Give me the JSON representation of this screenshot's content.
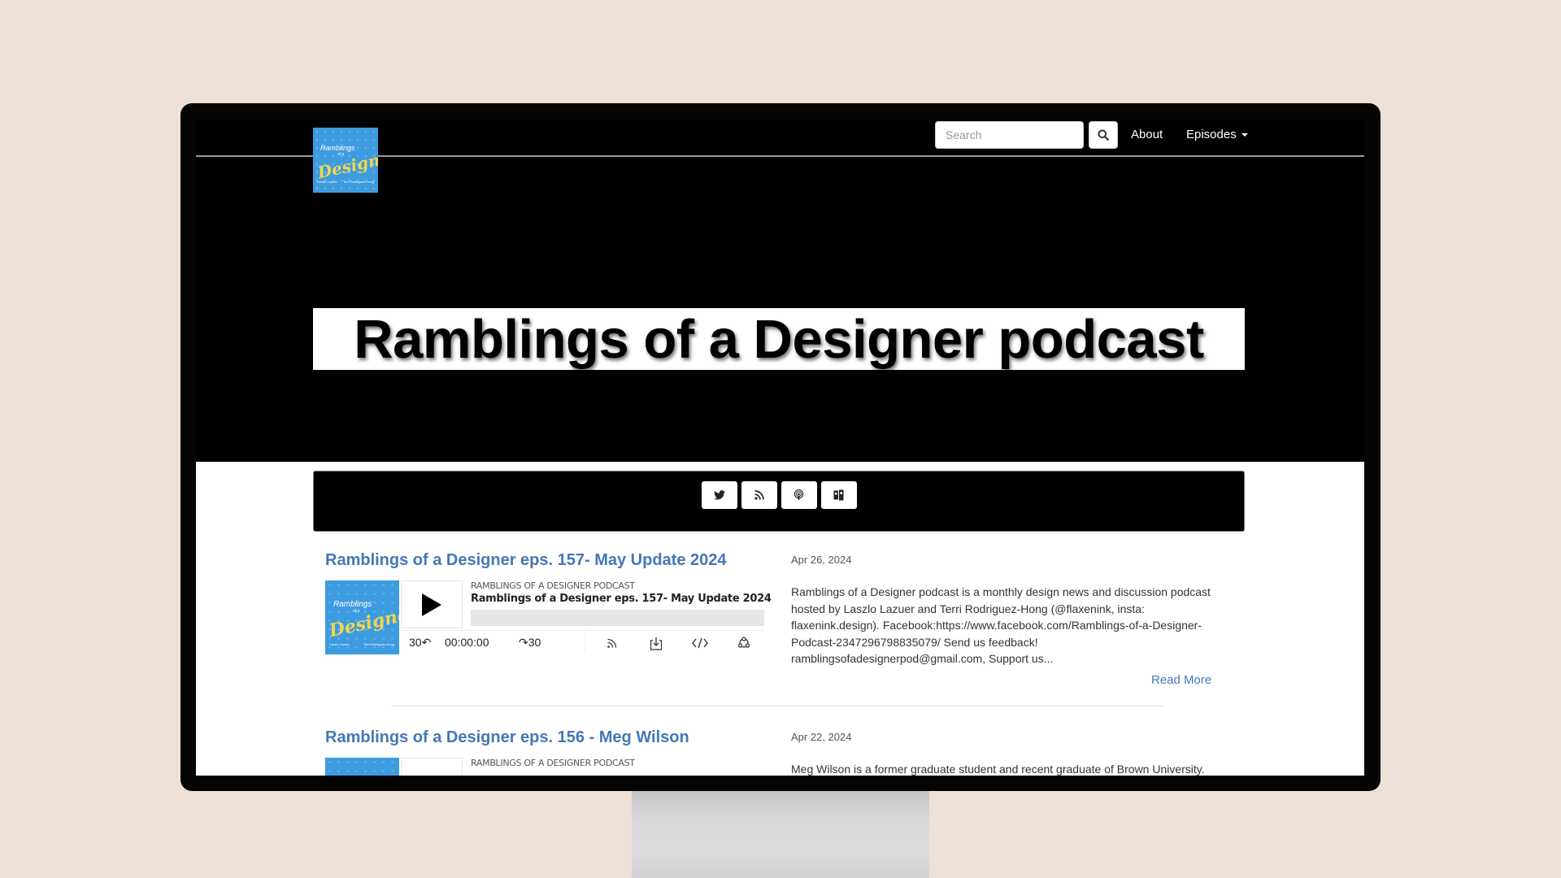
{
  "nav": {
    "logo_alt": "Ramblings of a Designer logo",
    "logo_lines": [
      "Ramblings",
      "of a",
      "Designer"
    ],
    "logo_hosts": [
      "Laszlo Lazuer",
      "Terri Rodriguez-Hong"
    ],
    "search_placeholder": "Search",
    "search_value": "",
    "search_icon": "search-icon",
    "about_label": "About",
    "episodes_label": "Episodes"
  },
  "hero": {
    "title": "Ramblings of a Designer podcast"
  },
  "social": {
    "buttons": [
      {
        "name": "twitter",
        "icon": "twitter-icon"
      },
      {
        "name": "rss",
        "icon": "rss-icon"
      },
      {
        "name": "apple-podcasts",
        "icon": "podcast-icon"
      },
      {
        "name": "podbean",
        "icon": "podbean-icon"
      }
    ]
  },
  "colors": {
    "accent_link": "#4577b5",
    "background": "#ece0d7",
    "logo_blue": "#3d9be0",
    "logo_yellow": "#f2d54a"
  },
  "episodes": [
    {
      "title": "Ramblings of a Designer eps. 157- May Update 2024",
      "date": "Apr 26, 2024",
      "description": "Ramblings of a Designer podcast is a monthly design news and discussion podcast hosted by Laszlo Lazuer and Terri Rodriguez-Hong (@flaxenink, insta: flaxenink.design). Facebook:https://www.facebook.com/Ramblings-of-a-Designer-Podcast-2347296798835079/ Send us feedback! ramblingsofadesignerpod@gmail.com, Support us...",
      "read_more": "Read More",
      "player": {
        "show_name": "RAMBLINGS OF A DESIGNER PODCAST",
        "episode_title": "Ramblings of a Designer eps. 157- May Update 2024",
        "rewind_label": "30↶",
        "time": "00:00:00",
        "forward_label": "↷30",
        "progress": 0
      }
    },
    {
      "title": "Ramblings of a Designer eps. 156 - Meg Wilson",
      "date": "Apr 22, 2024",
      "description": "Meg Wilson is a former graduate student and recent graduate of Brown University.",
      "player": {
        "show_name": "RAMBLINGS OF A DESIGNER PODCAST"
      }
    }
  ]
}
